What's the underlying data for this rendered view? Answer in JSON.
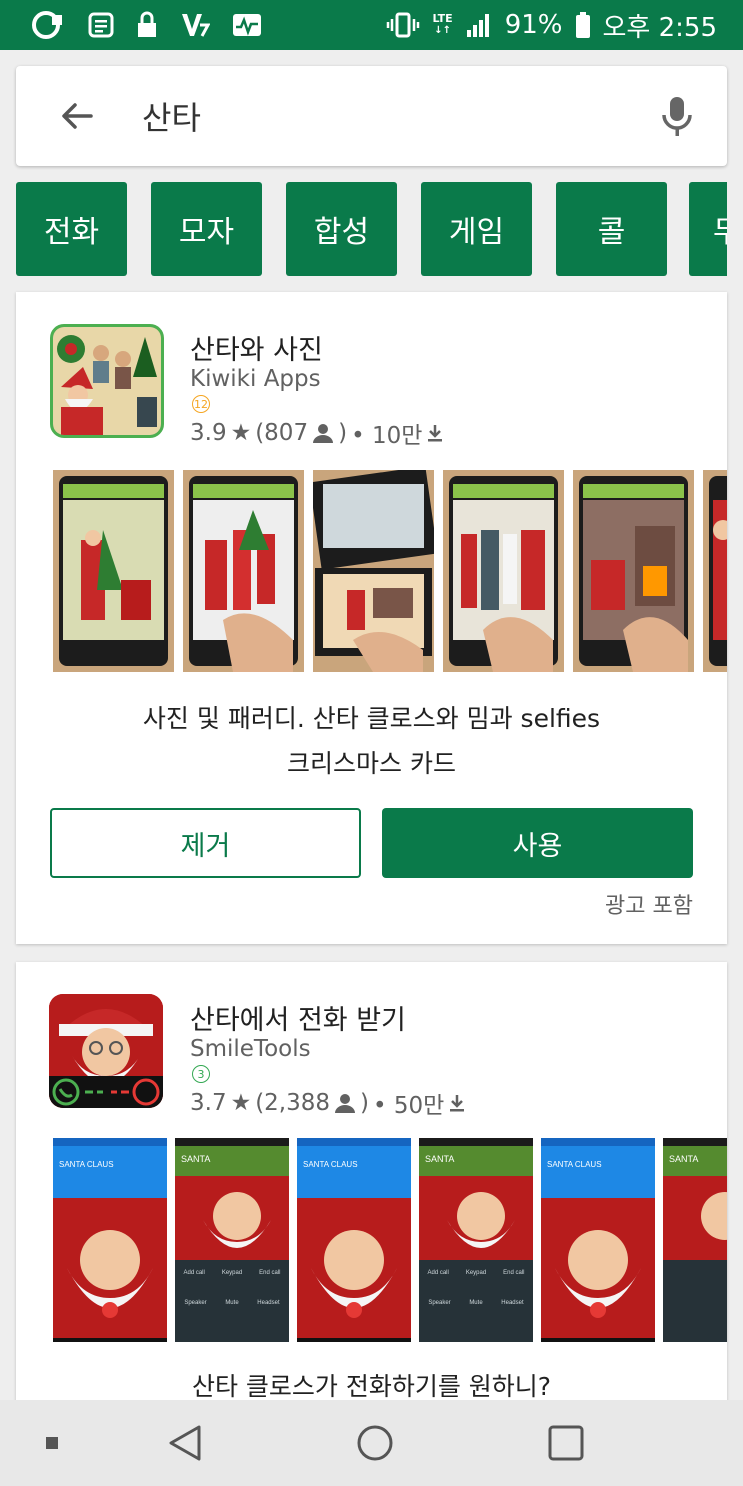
{
  "status_bar": {
    "battery": "91%",
    "time": "오후 2:55",
    "network": "LTE",
    "left_icons": [
      "u-plus-icon",
      "message-icon",
      "lock-icon",
      "v3-icon",
      "activity-icon"
    ],
    "background": "#0a7a4a"
  },
  "search": {
    "query": "산타"
  },
  "chips": [
    "전화",
    "모자",
    "합성",
    "게임",
    "콜",
    "무"
  ],
  "apps": [
    {
      "title": "산타와 사진",
      "developer": "Kiwiki Apps",
      "age_rating": "12",
      "age_color": "#f5a623",
      "rating": "3.9",
      "reviews": "(807",
      "reviews_close": ")",
      "installs": "• 10만",
      "description_line1": "사진 및 패러디. 산타 클로스와 밈과 selfies",
      "description_line2": "크리스마스 카드",
      "remove_label": "제거",
      "use_label": "사용",
      "ads_note": "광고 포함"
    },
    {
      "title": "산타에서 전화 받기",
      "developer": "SmileTools",
      "age_rating": "3",
      "age_color": "#34a853",
      "rating": "3.7",
      "reviews": "(2,388",
      "reviews_close": ")",
      "installs": "• 50만",
      "description_line1": "산타 클로스가 전화하기를 원하니?"
    }
  ],
  "call_screens": {
    "caller_blue": "SANTA CLAUS",
    "caller_green": "SANTA",
    "buttons_row1": [
      "Add call",
      "Keypad",
      "End call"
    ],
    "buttons_row2": [
      "Speaker",
      "Mute",
      "Headset"
    ]
  },
  "accent_color": "#0a7a4a"
}
